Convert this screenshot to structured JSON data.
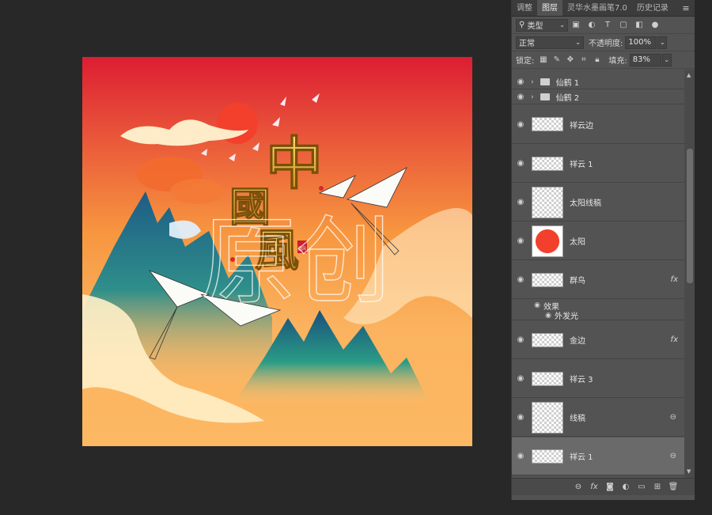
{
  "panel": {
    "tabs": [
      {
        "label": "调整"
      },
      {
        "label": "图层"
      },
      {
        "label": "灵华水墨画笔7.0"
      },
      {
        "label": "历史记录"
      }
    ],
    "menu_icon": "hamburger-icon",
    "filter": {
      "kind_label": "类型"
    },
    "blend_mode": "正常",
    "opacity_label": "不透明度:",
    "opacity_value": "100%",
    "lock_label": "锁定:",
    "fill_label": "填充:",
    "fill_value": "83%"
  },
  "layers": [
    {
      "name": "仙鹤 1",
      "type": "group"
    },
    {
      "name": "仙鹤 2",
      "type": "group"
    },
    {
      "name": "祥云边",
      "type": "layer"
    },
    {
      "name": "祥云 1",
      "type": "layer"
    },
    {
      "name": "太阳线稿",
      "type": "layer"
    },
    {
      "name": "太阳",
      "type": "layer"
    },
    {
      "name": "群鸟",
      "type": "layer",
      "fx": "fx"
    },
    {
      "name": "效果",
      "type": "effects"
    },
    {
      "name": "外发光",
      "type": "effect"
    },
    {
      "name": "金边",
      "type": "layer",
      "fx": "fx"
    },
    {
      "name": "祥云 3",
      "type": "layer"
    },
    {
      "name": "线稿",
      "type": "layer",
      "linked": true
    },
    {
      "name": "祥云 1",
      "type": "layer",
      "linked": true,
      "selected": true
    }
  ],
  "artwork": {
    "title_chars": [
      "中",
      "國",
      "風"
    ],
    "seal_text": "国风",
    "watermark": "原创",
    "colors": {
      "top": "#dc1d33",
      "bottom": "#fdb864",
      "sun": "#f2402d",
      "gold": "#e8b923"
    }
  }
}
